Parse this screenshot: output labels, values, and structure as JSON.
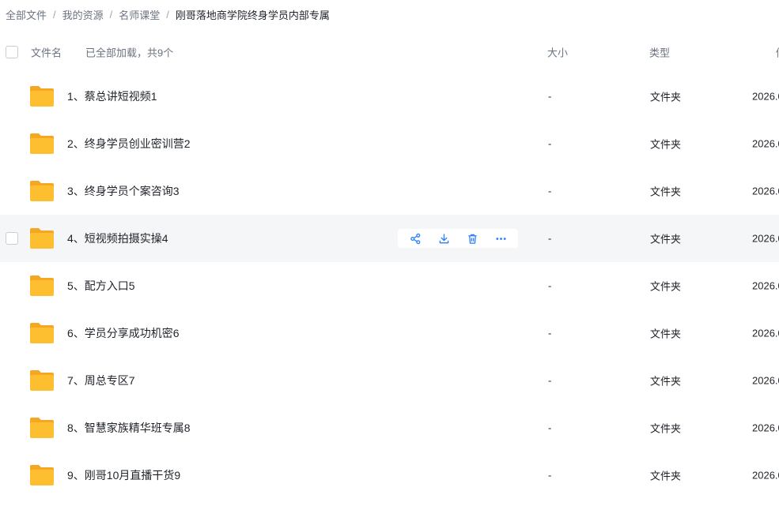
{
  "breadcrumb": [
    {
      "label": "全部文件"
    },
    {
      "label": "我的资源"
    },
    {
      "label": "名师课堂"
    },
    {
      "label": "刚哥落地商学院终身学员内部专属"
    }
  ],
  "breadcrumb_separator": "/",
  "header": {
    "name": "文件名",
    "loaded": "已全部加载，共9个",
    "size": "大小",
    "type": "类型",
    "date": "修"
  },
  "files": [
    {
      "name": "1、蔡总讲短视频1",
      "size": "-",
      "type": "文件夹",
      "date": "2026.0"
    },
    {
      "name": "2、终身学员创业密训营2",
      "size": "-",
      "type": "文件夹",
      "date": "2026.0"
    },
    {
      "name": "3、终身学员个案咨询3",
      "size": "-",
      "type": "文件夹",
      "date": "2026.0"
    },
    {
      "name": "4、短视频拍摄实操4",
      "size": "-",
      "type": "文件夹",
      "date": "2026.0",
      "hover": true
    },
    {
      "name": "5、配方入口5",
      "size": "-",
      "type": "文件夹",
      "date": "2026.0"
    },
    {
      "name": "6、学员分享成功机密6",
      "size": "-",
      "type": "文件夹",
      "date": "2026.0"
    },
    {
      "name": "7、周总专区7",
      "size": "-",
      "type": "文件夹",
      "date": "2026.0"
    },
    {
      "name": "8、智慧家族精华班专属8",
      "size": "-",
      "type": "文件夹",
      "date": "2026.0"
    },
    {
      "name": "9、刚哥10月直播干货9",
      "size": "-",
      "type": "文件夹",
      "date": "2026.0"
    }
  ],
  "row_actions": [
    "share-icon",
    "download-icon",
    "delete-icon",
    "more-icon"
  ],
  "colors": {
    "accent": "#2b7fff",
    "folder": "#fdbf2f",
    "folder_tab": "#f5a623",
    "hover_row": "#f5f6f8"
  }
}
